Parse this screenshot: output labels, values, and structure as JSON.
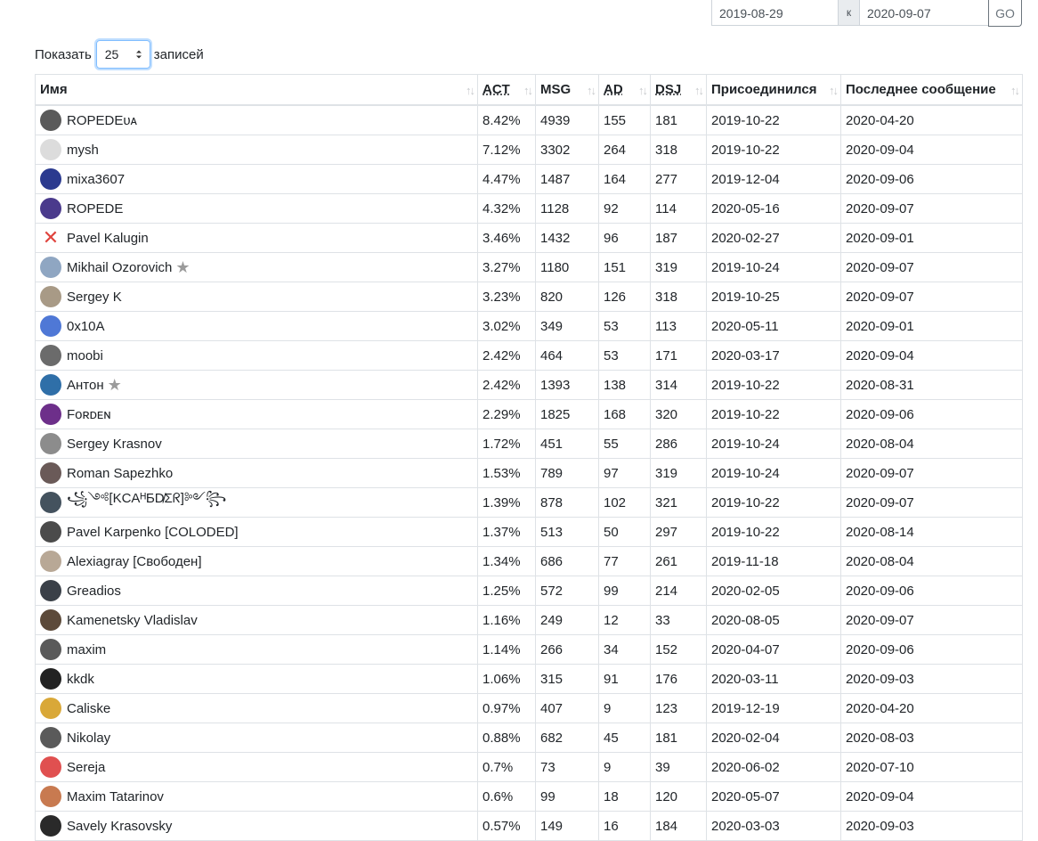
{
  "date_range": {
    "from": "2019-08-29",
    "separator": "к",
    "to": "2020-09-07",
    "go_label": "GO"
  },
  "show_entries": {
    "prefix": "Показать",
    "value": "25",
    "suffix": "записей"
  },
  "table": {
    "columns": [
      {
        "label": "Имя"
      },
      {
        "label": "ACT"
      },
      {
        "label": "MSG"
      },
      {
        "label": "AD"
      },
      {
        "label": "DSJ"
      },
      {
        "label": "Присоединился"
      },
      {
        "label": "Последнее сообщение"
      }
    ],
    "rows": [
      {
        "name": "ROPEDEᴜᴀ",
        "avatar_color": "#5a5a5a",
        "star": false,
        "act": "8.42%",
        "msg": "4939",
        "ad": "155",
        "dsj": "181",
        "joined": "2019-10-22",
        "last": "2020-04-20"
      },
      {
        "name": "mysh",
        "avatar_color": "#dcdcdc",
        "star": false,
        "act": "7.12%",
        "msg": "3302",
        "ad": "264",
        "dsj": "318",
        "joined": "2019-10-22",
        "last": "2020-09-04"
      },
      {
        "name": "mixa3607",
        "avatar_color": "#2b3a8f",
        "star": false,
        "act": "4.47%",
        "msg": "1487",
        "ad": "164",
        "dsj": "277",
        "joined": "2019-12-04",
        "last": "2020-09-06"
      },
      {
        "name": "ROPEDE",
        "avatar_color": "#4a3a8c",
        "star": false,
        "act": "4.32%",
        "msg": "1128",
        "ad": "92",
        "dsj": "114",
        "joined": "2020-05-16",
        "last": "2020-09-07"
      },
      {
        "name": "Pavel Kalugin",
        "avatar_color": "cross",
        "star": false,
        "act": "3.46%",
        "msg": "1432",
        "ad": "96",
        "dsj": "187",
        "joined": "2020-02-27",
        "last": "2020-09-01"
      },
      {
        "name": "Mikhail Ozorovich",
        "avatar_color": "#8fa6c2",
        "star": true,
        "act": "3.27%",
        "msg": "1180",
        "ad": "151",
        "dsj": "319",
        "joined": "2019-10-24",
        "last": "2020-09-07"
      },
      {
        "name": "Sergey K",
        "avatar_color": "#a89a86",
        "star": false,
        "act": "3.23%",
        "msg": "820",
        "ad": "126",
        "dsj": "318",
        "joined": "2019-10-25",
        "last": "2020-09-07"
      },
      {
        "name": "0x10A",
        "avatar_color": "#4f78d6",
        "star": false,
        "act": "3.02%",
        "msg": "349",
        "ad": "53",
        "dsj": "113",
        "joined": "2020-05-11",
        "last": "2020-09-01"
      },
      {
        "name": "moobi",
        "avatar_color": "#6b6b6b",
        "star": false,
        "act": "2.42%",
        "msg": "464",
        "ad": "53",
        "dsj": "171",
        "joined": "2020-03-17",
        "last": "2020-09-04"
      },
      {
        "name": "Антон",
        "avatar_color": "#2f6fa8",
        "star": true,
        "act": "2.42%",
        "msg": "1393",
        "ad": "138",
        "dsj": "314",
        "joined": "2019-10-22",
        "last": "2020-08-31"
      },
      {
        "name": "Fᴏʀᴅᴇɴ",
        "avatar_color": "#6d2f8a",
        "star": false,
        "act": "2.29%",
        "msg": "1825",
        "ad": "168",
        "dsj": "320",
        "joined": "2019-10-22",
        "last": "2020-09-06"
      },
      {
        "name": "Sergey Krasnov",
        "avatar_color": "#8c8c8c",
        "star": false,
        "act": "1.72%",
        "msg": "451",
        "ad": "55",
        "dsj": "286",
        "joined": "2019-10-24",
        "last": "2020-08-04"
      },
      {
        "name": "Roman Sapezhko",
        "avatar_color": "#6a5a58",
        "star": false,
        "act": "1.53%",
        "msg": "789",
        "ad": "97",
        "dsj": "319",
        "joined": "2019-10-24",
        "last": "2020-09-07"
      },
      {
        "name": "꧁༺[KCAᴴƂD̸Σᖇ]༻꧂",
        "avatar_color": "#44525e",
        "star": false,
        "act": "1.39%",
        "msg": "878",
        "ad": "102",
        "dsj": "321",
        "joined": "2019-10-22",
        "last": "2020-09-07"
      },
      {
        "name": "Pavel Karpenko [COLODED]",
        "avatar_color": "#4b4b4b",
        "star": false,
        "act": "1.37%",
        "msg": "513",
        "ad": "50",
        "dsj": "297",
        "joined": "2019-10-22",
        "last": "2020-08-14"
      },
      {
        "name": "Alexiagray [Свободен]",
        "avatar_color": "#b8a896",
        "star": false,
        "act": "1.34%",
        "msg": "686",
        "ad": "77",
        "dsj": "261",
        "joined": "2019-11-18",
        "last": "2020-08-04"
      },
      {
        "name": "Greadios",
        "avatar_color": "#3a4048",
        "star": false,
        "act": "1.25%",
        "msg": "572",
        "ad": "99",
        "dsj": "214",
        "joined": "2020-02-05",
        "last": "2020-09-06"
      },
      {
        "name": "Kamenetsky Vladislav",
        "avatar_color": "#5c4a3a",
        "star": false,
        "act": "1.16%",
        "msg": "249",
        "ad": "12",
        "dsj": "33",
        "joined": "2020-08-05",
        "last": "2020-09-07"
      },
      {
        "name": "maxim",
        "avatar_color": "#5a5a5a",
        "star": false,
        "act": "1.14%",
        "msg": "266",
        "ad": "34",
        "dsj": "152",
        "joined": "2020-04-07",
        "last": "2020-09-06"
      },
      {
        "name": "kkdk",
        "avatar_color": "#222222",
        "star": false,
        "act": "1.06%",
        "msg": "315",
        "ad": "91",
        "dsj": "176",
        "joined": "2020-03-11",
        "last": "2020-09-03"
      },
      {
        "name": "Caliske",
        "avatar_color": "#d9a838",
        "star": false,
        "act": "0.97%",
        "msg": "407",
        "ad": "9",
        "dsj": "123",
        "joined": "2019-12-19",
        "last": "2020-04-20"
      },
      {
        "name": "Nikolay",
        "avatar_color": "#5a5a5a",
        "star": false,
        "act": "0.88%",
        "msg": "682",
        "ad": "45",
        "dsj": "181",
        "joined": "2020-02-04",
        "last": "2020-08-03"
      },
      {
        "name": "Sereja",
        "avatar_color": "#e05050",
        "star": false,
        "act": "0.7%",
        "msg": "73",
        "ad": "9",
        "dsj": "39",
        "joined": "2020-06-02",
        "last": "2020-07-10"
      },
      {
        "name": "Maxim Tatarinov",
        "avatar_color": "#c87a50",
        "star": false,
        "act": "0.6%",
        "msg": "99",
        "ad": "18",
        "dsj": "120",
        "joined": "2020-05-07",
        "last": "2020-09-04"
      },
      {
        "name": "Savely Krasovsky",
        "avatar_color": "#2a2a2a",
        "star": false,
        "act": "0.57%",
        "msg": "149",
        "ad": "16",
        "dsj": "184",
        "joined": "2020-03-03",
        "last": "2020-09-03"
      }
    ]
  }
}
